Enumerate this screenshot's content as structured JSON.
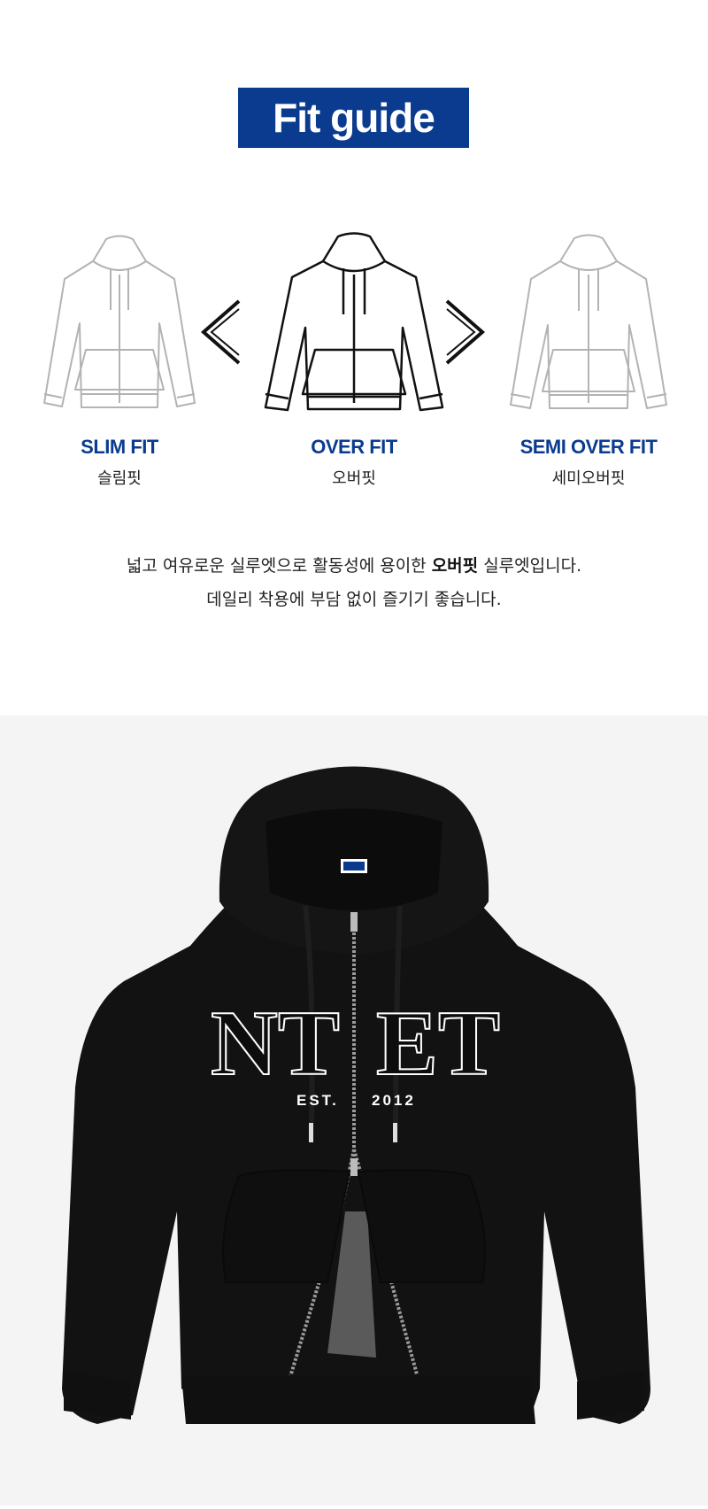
{
  "header": {
    "title": "Fit guide"
  },
  "fits": [
    {
      "en": "SLIM FIT",
      "ko": "슬림핏",
      "state": "inactive"
    },
    {
      "en": "OVER FIT",
      "ko": "오버핏",
      "state": "active"
    },
    {
      "en": "SEMI OVER FIT",
      "ko": "세미오버핏",
      "state": "inactive"
    }
  ],
  "description": {
    "line1_before": "넓고 여유로운 실루엣으로 활동성에 용이한 ",
    "line1_bold": "오버핏",
    "line1_after": " 실루엣입니다.",
    "line2": "데일리 착용에 부담 없이 즐기기 좋습니다."
  },
  "product": {
    "label_tag": "Ntet",
    "print_main_left": "NT",
    "print_main_right": "ET",
    "print_sub_left": "EST.",
    "print_sub_right": "2012"
  },
  "colors": {
    "brand_blue": "#0b3b8f",
    "inactive_outline": "#b3b3b3",
    "active_outline": "#111111",
    "garment": "#121212"
  }
}
